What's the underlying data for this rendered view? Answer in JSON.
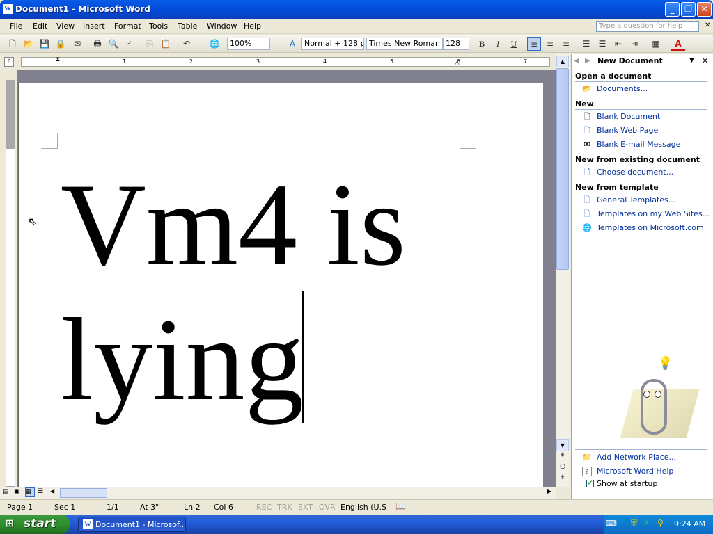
{
  "window": {
    "title": "Document1 - Microsoft Word"
  },
  "menu": [
    "File",
    "Edit",
    "View",
    "Insert",
    "Format",
    "Tools",
    "Table",
    "Window",
    "Help"
  ],
  "help_placeholder": "Type a question for help",
  "toolbar": {
    "zoom": "100%",
    "style": "Normal + 128 p",
    "font": "Times New Roman",
    "size": "128",
    "bold": "B",
    "italic": "I",
    "underline": "U"
  },
  "ruler": {
    "numbers": [
      "1",
      "1",
      "2",
      "3",
      "4",
      "5",
      "6",
      "7"
    ]
  },
  "document": {
    "line1": "Vm4 is",
    "line2": "lying"
  },
  "taskpane": {
    "title": "New Document",
    "sections": {
      "open": "Open a document",
      "documents": "Documents...",
      "new": "New",
      "blank_doc": "Blank Document",
      "blank_web": "Blank Web Page",
      "blank_email": "Blank E-mail Message",
      "existing": "New from existing document",
      "choose": "Choose document...",
      "template": "New from template",
      "general": "General Templates...",
      "web_sites": "Templates on my Web Sites...",
      "ms": "Templates on Microsoft.com"
    },
    "add_network": "Add Network Place...",
    "word_help": "Microsoft Word Help",
    "show_startup": "Show at startup"
  },
  "status": {
    "page": "Page 1",
    "sec": "Sec 1",
    "pages": "1/1",
    "at": "At 3\"",
    "ln": "Ln 2",
    "col": "Col 6",
    "rec": "REC",
    "trk": "TRK",
    "ext": "EXT",
    "ovr": "OVR",
    "lang": "English (U.S"
  },
  "taskbar": {
    "start": "start",
    "window_btn": "Document1 - Microsof...",
    "clock": "9:24 AM"
  }
}
